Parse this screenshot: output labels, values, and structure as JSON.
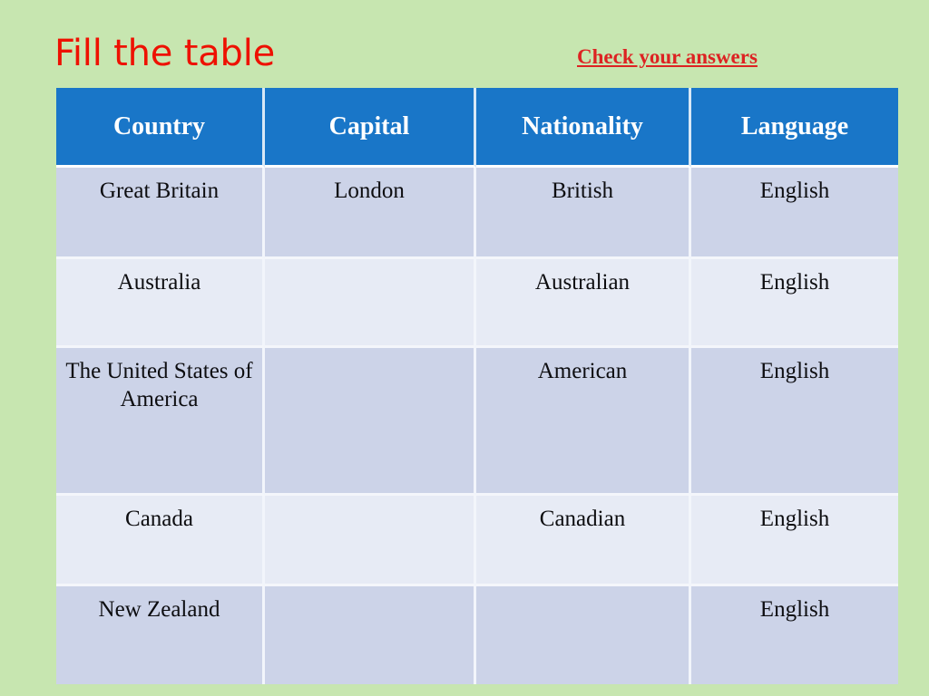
{
  "slide": {
    "background_color": "#c7e6b0",
    "title": "Fill the table",
    "title_color": "#ee1100",
    "check_answers_label": "Check your answers",
    "check_answers_color": "#dd2222"
  },
  "table": {
    "header_bg": "#1976c8",
    "header_text_color": "#ffffff",
    "row_shade_a": "#ccd3e8",
    "row_shade_b": "#e7ebf5",
    "columns": [
      "Country",
      "Capital",
      "Nationality",
      "Language"
    ],
    "rows": [
      {
        "country": "Great Britain",
        "capital": "London",
        "nationality": "British",
        "language": "English"
      },
      {
        "country": "Australia",
        "capital": "",
        "nationality": "Australian",
        "language": "English"
      },
      {
        "country": "The United States of America",
        "capital": "",
        "nationality": "American",
        "language": "English"
      },
      {
        "country": "Canada",
        "capital": "",
        "nationality": "Canadian",
        "language": "English"
      },
      {
        "country": "New Zealand",
        "capital": "",
        "nationality": "",
        "language": "English"
      }
    ]
  }
}
